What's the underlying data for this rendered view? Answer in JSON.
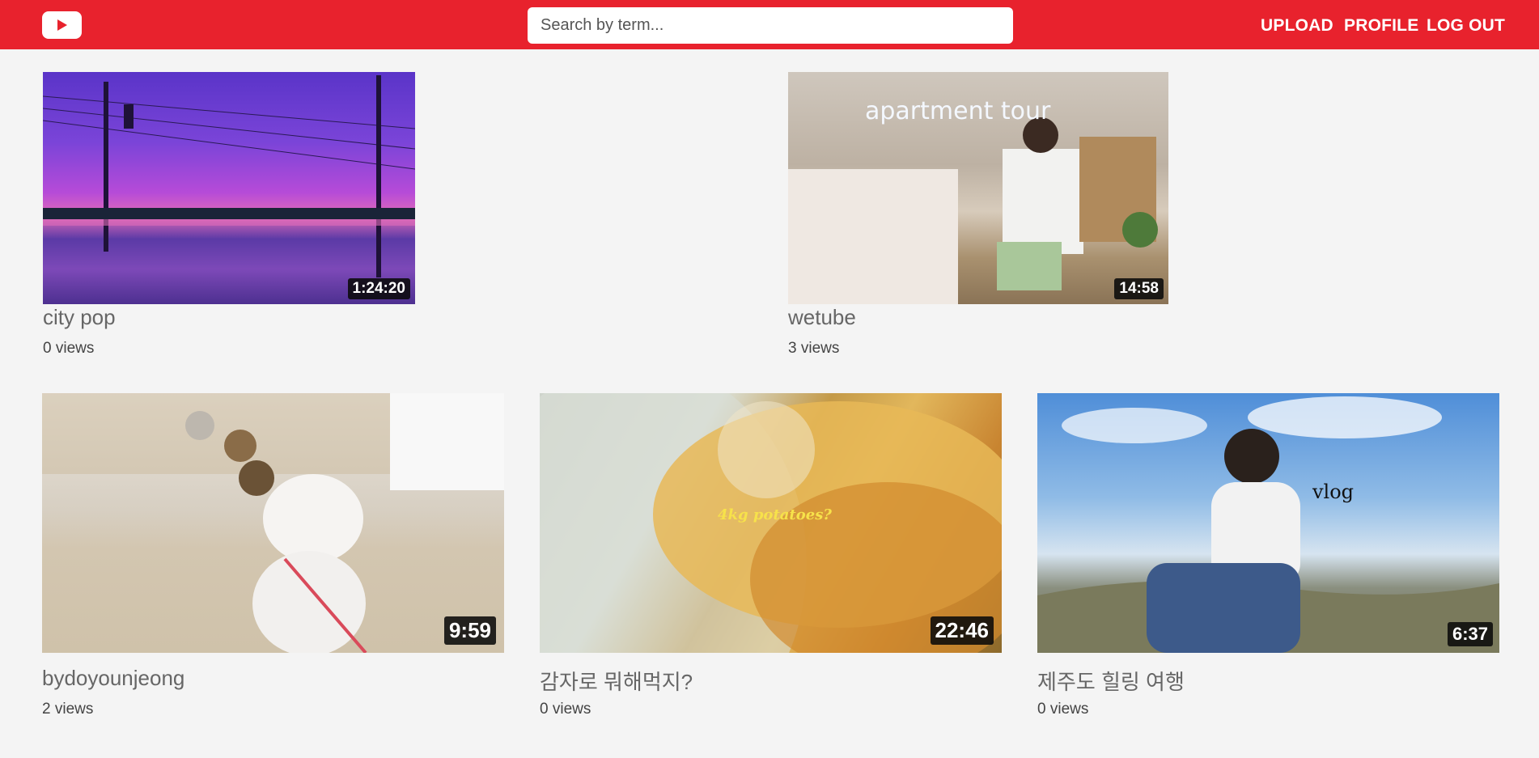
{
  "header": {
    "search_placeholder": "Search by term...",
    "nav": {
      "upload": "UPLOAD",
      "profile": "PROFILE",
      "logout": "LOG OUT"
    },
    "brand_color": "#e8222d"
  },
  "videos": [
    {
      "title": "city pop",
      "views": "0 views",
      "duration": "1:24:20"
    },
    {
      "title": "wetube",
      "views": "3 views",
      "duration": "14:58"
    },
    {
      "title": "bydoyounjeong",
      "views": "2 views",
      "duration": "9:59"
    },
    {
      "title": "감자로 뭐해먹지?",
      "views": "0 views",
      "duration": "22:46"
    },
    {
      "title": "제주도 힐링 여행",
      "views": "0 views",
      "duration": "6:37"
    }
  ]
}
